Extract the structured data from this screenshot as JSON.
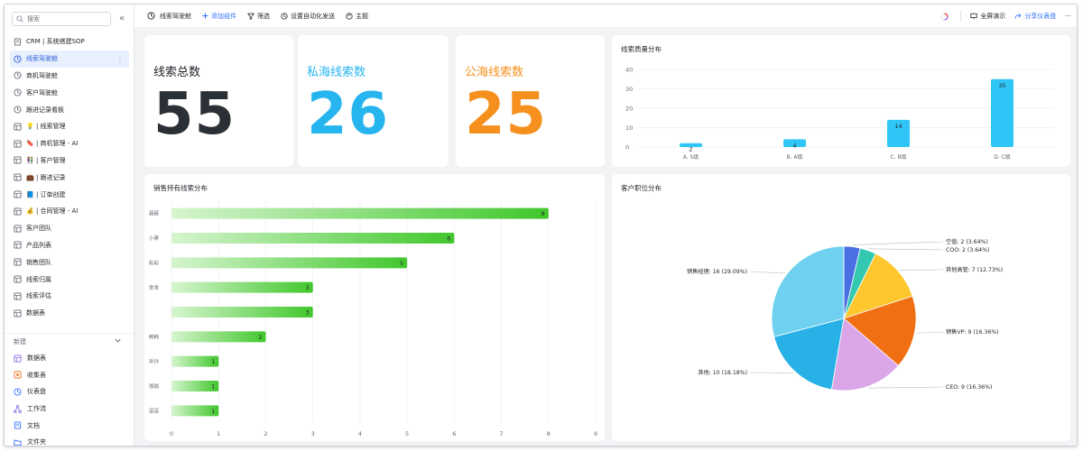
{
  "sidebar": {
    "search_placeholder": "搜索",
    "collapse": "«",
    "items": [
      {
        "label": "CRM | 系统搭建SOP",
        "icon": "doc-icon"
      },
      {
        "label": "线索驾驶舱",
        "icon": "dashboard-icon"
      },
      {
        "label": "商机驾驶舱",
        "icon": "dashboard-icon"
      },
      {
        "label": "客户驾驶舱",
        "icon": "dashboard-icon"
      },
      {
        "label": "跟进记录看板",
        "icon": "dashboard-icon"
      },
      {
        "label": "💡 | 线索管理",
        "icon": "table-icon"
      },
      {
        "label": "🔖 | 商机管理 - AI",
        "icon": "table-icon"
      },
      {
        "label": "👫 | 客户管理",
        "icon": "table-icon"
      },
      {
        "label": "💼 | 跟进记录",
        "icon": "table-icon"
      },
      {
        "label": "📘 | 订单创建",
        "icon": "table-icon"
      },
      {
        "label": "💰 | 合同管理 - AI",
        "icon": "table-icon"
      },
      {
        "label": "客户团队",
        "icon": "table-icon"
      },
      {
        "label": "产品列表",
        "icon": "table-icon"
      },
      {
        "label": "销售团队",
        "icon": "table-icon"
      },
      {
        "label": "线索归属",
        "icon": "table-icon"
      },
      {
        "label": "线索评估",
        "icon": "table-icon"
      },
      {
        "label": "数据表",
        "icon": "table-icon"
      }
    ],
    "active_index": 1,
    "new_section": {
      "title": "新建",
      "items": [
        {
          "label": "数据表",
          "icon": "table-icon",
          "color": "#8c6be8"
        },
        {
          "label": "收集表",
          "icon": "form-icon",
          "color": "#f07a2b"
        },
        {
          "label": "仪表盘",
          "icon": "dashboard-icon",
          "color": "#3370ff"
        },
        {
          "label": "工作流",
          "icon": "workflow-icon",
          "color": "#8c6be8"
        },
        {
          "label": "文档",
          "icon": "doc-icon",
          "color": "#3370ff"
        },
        {
          "label": "文件夹",
          "icon": "folder-icon",
          "color": "#3370ff"
        }
      ]
    }
  },
  "toolbar": {
    "title": "线索驾驶舱",
    "add_widget": "添加组件",
    "filter": "筛选",
    "auto_send": "设置自动化发送",
    "theme": "主题",
    "fullscreen": "全屏演示",
    "share": "分享仪表盘",
    "more": "···"
  },
  "kpis": [
    {
      "label": "线索总数",
      "value": "55",
      "color": "#2b2f36"
    },
    {
      "label": "私海线索数",
      "value": "26",
      "color": "#26b5ef"
    },
    {
      "label": "公海线索数",
      "value": "25",
      "color": "#f5901e"
    }
  ],
  "colors": {
    "accent": "#3370ff",
    "bar_blue": "#30c5f7",
    "bar_green": "#41c72c"
  },
  "chart_data": [
    {
      "type": "bar",
      "title": "线索质量分布",
      "categories": [
        "A. S级",
        "B. A级",
        "C. B级",
        "D. C级"
      ],
      "values": [
        2,
        4,
        14,
        35
      ],
      "ylim": [
        0,
        40
      ],
      "yticks": [
        0,
        10,
        20,
        30,
        40
      ],
      "grid": true
    },
    {
      "type": "bar",
      "orientation": "horizontal",
      "title": "销售持有线索分布",
      "categories": [
        "聂聂",
        "小菁",
        "彩彩",
        "金金",
        "",
        "韩韩",
        "孙孙",
        "珈珈",
        "逗逗"
      ],
      "values": [
        8,
        6,
        5,
        3,
        3,
        2,
        1,
        1,
        1
      ],
      "xlim": [
        0,
        9
      ],
      "xticks": [
        0,
        1,
        2,
        3,
        4,
        5,
        6,
        7,
        8,
        9
      ],
      "grid": true
    },
    {
      "type": "pie",
      "title": "客户职位分布",
      "slices": [
        {
          "label": "空值",
          "value": 2,
          "text": "空值: 2 (3.64%)",
          "color": "#4a6fe3"
        },
        {
          "label": "COO",
          "value": 2,
          "text": "COO: 2 (3.64%)",
          "color": "#33c9b0"
        },
        {
          "label": "其他高管",
          "value": 7,
          "text": "其他高管: 7 (12.73%)",
          "color": "#fdc72d"
        },
        {
          "label": "销售VP",
          "value": 9,
          "text": "销售VP: 9 (16.36%)",
          "color": "#f06f12"
        },
        {
          "label": "CEO",
          "value": 9,
          "text": "CEO: 9 (16.36%)",
          "color": "#dba6e8"
        },
        {
          "label": "其他",
          "value": 10,
          "text": "其他: 10 (18.18%)",
          "color": "#28b1e6"
        },
        {
          "label": "销售经理",
          "value": 16,
          "text": "销售经理: 16 (29.09%)",
          "color": "#6fd0ef"
        }
      ]
    }
  ]
}
